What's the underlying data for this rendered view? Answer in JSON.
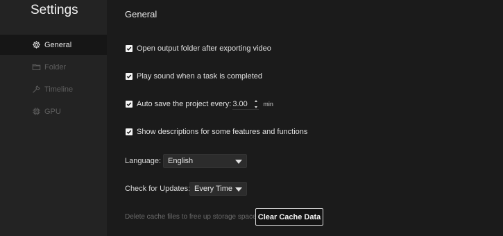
{
  "app": {
    "title": "Settings"
  },
  "sidebar": {
    "items": [
      {
        "label": "General",
        "icon": "gear-icon",
        "active": true
      },
      {
        "label": "Folder",
        "icon": "folder-icon",
        "active": false
      },
      {
        "label": "Timeline",
        "icon": "wrench-icon",
        "active": false
      },
      {
        "label": "GPU",
        "icon": "chip-icon",
        "active": false
      }
    ]
  },
  "general": {
    "title": "General",
    "options": [
      {
        "label": "Open output folder after exporting video",
        "checked": true
      },
      {
        "label": "Play sound when a task is completed",
        "checked": true
      },
      {
        "label": "Auto save the project every:",
        "checked": true
      },
      {
        "label": "Show descriptions for some features and functions",
        "checked": true
      }
    ],
    "autosave": {
      "value": "3.00",
      "unit": "min"
    },
    "language": {
      "label": "Language:",
      "value": "English"
    },
    "updates": {
      "label": "Check for Updates:",
      "value": "Every Time"
    },
    "cache": {
      "hint": "Delete cache files to free up storage space",
      "button": "Clear Cache Data"
    }
  },
  "colors": {
    "sidebar": "#232323",
    "sidebar_active": "#161616",
    "content": "#1b1b1b",
    "checkbox": "#f4f4f4"
  }
}
